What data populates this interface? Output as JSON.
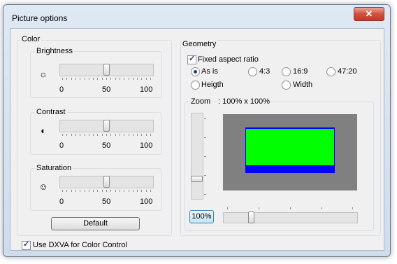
{
  "window": {
    "title": "Picture options",
    "close_glyph": "✕"
  },
  "color": {
    "label": "Color",
    "sliders": [
      {
        "label": "Brightness",
        "icon": "sun-icon",
        "glyph": "☼",
        "value": 50,
        "ticks": [
          "0",
          "50",
          "100"
        ]
      },
      {
        "label": "Contrast",
        "icon": "contrast-icon",
        "glyph": "◐",
        "value": 50,
        "ticks": [
          "0",
          "50",
          "100"
        ]
      },
      {
        "label": "Saturation",
        "icon": "saturation-icon",
        "glyph": "☺",
        "value": 50,
        "ticks": [
          "0",
          "50",
          "100"
        ]
      }
    ],
    "default_label": "Default"
  },
  "geometry": {
    "label": "Geometry",
    "fixed_aspect_label": "Fixed aspect ratio",
    "fixed_aspect_checked": true,
    "options": [
      "As is",
      "4:3",
      "16:9",
      "47:20",
      "Heigth",
      "Width"
    ],
    "selected": "As is",
    "zoom_label": "Zoom",
    "zoom_value": ": 100% x 100%",
    "zoom_button": "100%"
  },
  "dxva": {
    "label": "Use DXVA for Color Control",
    "checked": true
  },
  "colors": {
    "preview_bg": "#808080",
    "video_green": "#00ff00",
    "video_blue": "#0000ff"
  }
}
